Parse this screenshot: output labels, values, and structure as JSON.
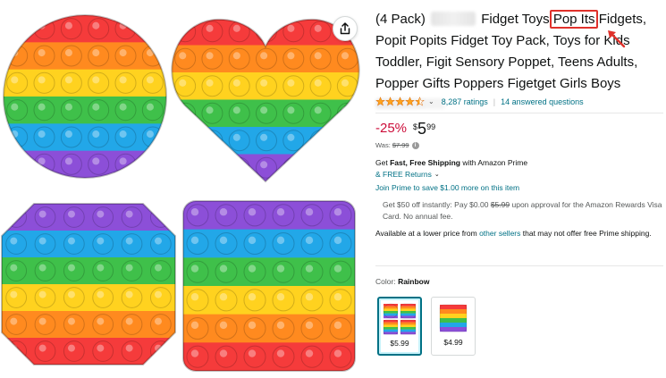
{
  "product": {
    "title_part1": "(4 Pack)",
    "title_part2": "Fidget Toys",
    "title_highlight": "Pop Its",
    "title_part3": "Fidgets, Popit Popits Fidget Toy Pack, Toys for Kids Toddler, Figit Sensory Poppet, Teens Adults, Popper Gifts Poppers Figetget Girls Boys"
  },
  "rating": {
    "stars": 4.5,
    "ratings_label": "8,287 ratings",
    "questions_label": "14 answered questions"
  },
  "pricing": {
    "discount": "-25%",
    "currency": "$",
    "whole": "5",
    "fraction": "99",
    "was_label": "Was:",
    "was_price": "$7.99",
    "info_glyph": "i"
  },
  "shipping": {
    "get_label": "Get",
    "fast_free": "Fast, Free Shipping",
    "with_prime": "with Amazon Prime",
    "free_returns": "& FREE Returns",
    "prime_offer": "Join Prime to save $1.00 more on this item"
  },
  "card_offer": {
    "text_before": "Get $50 off instantly: Pay $0.00",
    "strike_price": "$5.99",
    "text_after": "upon approval for the Amazon Rewards Visa Card. No annual fee."
  },
  "lower_price": {
    "text_before": "Available at a lower price from",
    "link_text": "other sellers",
    "text_after": "that may not offer free Prime shipping."
  },
  "variation": {
    "label": "Color:",
    "value": "Rainbow",
    "swatches": [
      {
        "price": "$5.99",
        "selected": true
      },
      {
        "price": "$4.99",
        "selected": false
      }
    ]
  },
  "colors": {
    "accent_link": "#007185",
    "discount_red": "#cc0c39",
    "star_orange": "#ffa41c",
    "annotation_red": "#e0312b",
    "rainbow": [
      "#f53b3b",
      "#ff8a1f",
      "#ffd21f",
      "#3fc04a",
      "#22a7e8",
      "#8c4fd8"
    ]
  },
  "icons": {
    "share": "share-icon",
    "star": "star-icon",
    "chevron": "chevron-down-icon",
    "annotation_arrow": "arrow-icon"
  }
}
